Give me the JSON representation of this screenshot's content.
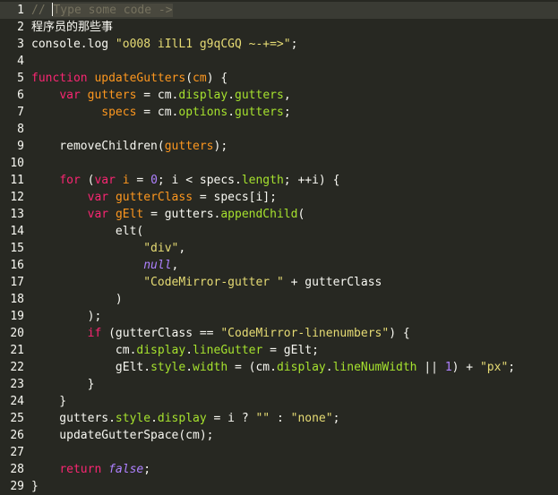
{
  "editor": {
    "placeholder": "Type some code ->",
    "theme_colors": {
      "background": "#272822",
      "active_line": "#3a3b34",
      "text": "#f8f8f2",
      "keyword": "#f92672",
      "variable": "#fd971f",
      "property": "#a6e22e",
      "string": "#e6db74",
      "number": "#ae81ff",
      "comment": "#75715e"
    },
    "lines": [
      {
        "n": "1",
        "tokens": [
          [
            "cm",
            "// "
          ],
          [
            "ph",
            "Type some code ->"
          ]
        ]
      },
      {
        "n": "2",
        "tokens": [
          [
            "plain",
            "程序员的那些事"
          ]
        ]
      },
      {
        "n": "3",
        "tokens": [
          [
            "plain",
            "console.log "
          ],
          [
            "str",
            "\"o008 iIlL1 g9qCGQ ~-+=>\""
          ],
          [
            "plain",
            ";"
          ]
        ]
      },
      {
        "n": "4",
        "tokens": []
      },
      {
        "n": "5",
        "tokens": [
          [
            "kw",
            "function "
          ],
          [
            "vdef",
            "updateGutters"
          ],
          [
            "plain",
            "("
          ],
          [
            "vdef",
            "cm"
          ],
          [
            "plain",
            ") {"
          ]
        ]
      },
      {
        "n": "6",
        "tokens": [
          [
            "plain",
            "    "
          ],
          [
            "kw",
            "var "
          ],
          [
            "vdef",
            "gutters"
          ],
          [
            "plain",
            " = "
          ],
          [
            "plain",
            "cm."
          ],
          [
            "prop",
            "display"
          ],
          [
            "plain",
            "."
          ],
          [
            "prop",
            "gutters"
          ],
          [
            "plain",
            ","
          ]
        ]
      },
      {
        "n": "7",
        "tokens": [
          [
            "plain",
            "          "
          ],
          [
            "vdef",
            "specs"
          ],
          [
            "plain",
            " = "
          ],
          [
            "plain",
            "cm."
          ],
          [
            "prop",
            "options"
          ],
          [
            "plain",
            "."
          ],
          [
            "prop",
            "gutters"
          ],
          [
            "plain",
            ";"
          ]
        ]
      },
      {
        "n": "8",
        "tokens": []
      },
      {
        "n": "9",
        "tokens": [
          [
            "plain",
            "    removeChildren("
          ],
          [
            "vdef",
            "gutters"
          ],
          [
            "plain",
            ");"
          ]
        ]
      },
      {
        "n": "10",
        "tokens": []
      },
      {
        "n": "11",
        "tokens": [
          [
            "plain",
            "    "
          ],
          [
            "kw",
            "for "
          ],
          [
            "plain",
            "("
          ],
          [
            "kw",
            "var "
          ],
          [
            "vdef",
            "i"
          ],
          [
            "plain",
            " = "
          ],
          [
            "num",
            "0"
          ],
          [
            "plain",
            "; i < specs."
          ],
          [
            "prop",
            "length"
          ],
          [
            "plain",
            "; ++i) {"
          ]
        ]
      },
      {
        "n": "12",
        "tokens": [
          [
            "plain",
            "        "
          ],
          [
            "kw",
            "var "
          ],
          [
            "vdef",
            "gutterClass"
          ],
          [
            "plain",
            " = specs[i];"
          ]
        ]
      },
      {
        "n": "13",
        "tokens": [
          [
            "plain",
            "        "
          ],
          [
            "kw",
            "var "
          ],
          [
            "vdef",
            "gElt"
          ],
          [
            "plain",
            " = gutters."
          ],
          [
            "prop",
            "appendChild"
          ],
          [
            "plain",
            "("
          ]
        ]
      },
      {
        "n": "14",
        "tokens": [
          [
            "plain",
            "            elt("
          ]
        ]
      },
      {
        "n": "15",
        "tokens": [
          [
            "plain",
            "                "
          ],
          [
            "str",
            "\"div\""
          ],
          [
            "plain",
            ","
          ]
        ]
      },
      {
        "n": "16",
        "tokens": [
          [
            "plain",
            "                "
          ],
          [
            "atom",
            "null"
          ],
          [
            "plain",
            ","
          ]
        ]
      },
      {
        "n": "17",
        "tokens": [
          [
            "plain",
            "                "
          ],
          [
            "str",
            "\"CodeMirror-gutter \""
          ],
          [
            "plain",
            " + gutterClass"
          ]
        ]
      },
      {
        "n": "18",
        "tokens": [
          [
            "plain",
            "            )"
          ]
        ]
      },
      {
        "n": "19",
        "tokens": [
          [
            "plain",
            "        );"
          ]
        ]
      },
      {
        "n": "20",
        "tokens": [
          [
            "plain",
            "        "
          ],
          [
            "kw",
            "if "
          ],
          [
            "plain",
            "(gutterClass == "
          ],
          [
            "str",
            "\"CodeMirror-linenumbers\""
          ],
          [
            "plain",
            ") {"
          ]
        ]
      },
      {
        "n": "21",
        "tokens": [
          [
            "plain",
            "            cm."
          ],
          [
            "prop",
            "display"
          ],
          [
            "plain",
            "."
          ],
          [
            "prop",
            "lineGutter"
          ],
          [
            "plain",
            " = gElt;"
          ]
        ]
      },
      {
        "n": "22",
        "tokens": [
          [
            "plain",
            "            gElt."
          ],
          [
            "prop",
            "style"
          ],
          [
            "plain",
            "."
          ],
          [
            "prop",
            "width"
          ],
          [
            "plain",
            " = (cm."
          ],
          [
            "prop",
            "display"
          ],
          [
            "plain",
            "."
          ],
          [
            "prop",
            "lineNumWidth"
          ],
          [
            "plain",
            " || "
          ],
          [
            "num",
            "1"
          ],
          [
            "plain",
            ") + "
          ],
          [
            "str",
            "\"px\""
          ],
          [
            "plain",
            ";"
          ]
        ]
      },
      {
        "n": "23",
        "tokens": [
          [
            "plain",
            "        }"
          ]
        ]
      },
      {
        "n": "24",
        "tokens": [
          [
            "plain",
            "    }"
          ]
        ]
      },
      {
        "n": "25",
        "tokens": [
          [
            "plain",
            "    gutters."
          ],
          [
            "prop",
            "style"
          ],
          [
            "plain",
            "."
          ],
          [
            "prop",
            "display"
          ],
          [
            "plain",
            " = i ? "
          ],
          [
            "str",
            "\"\""
          ],
          [
            "plain",
            " : "
          ],
          [
            "str",
            "\"none\""
          ],
          [
            "plain",
            ";"
          ]
        ]
      },
      {
        "n": "26",
        "tokens": [
          [
            "plain",
            "    updateGutterSpace(cm);"
          ]
        ]
      },
      {
        "n": "27",
        "tokens": []
      },
      {
        "n": "28",
        "tokens": [
          [
            "plain",
            "    "
          ],
          [
            "kw",
            "return "
          ],
          [
            "atom",
            "false"
          ],
          [
            "plain",
            ";"
          ]
        ]
      },
      {
        "n": "29",
        "tokens": [
          [
            "plain",
            "}"
          ]
        ]
      }
    ]
  }
}
